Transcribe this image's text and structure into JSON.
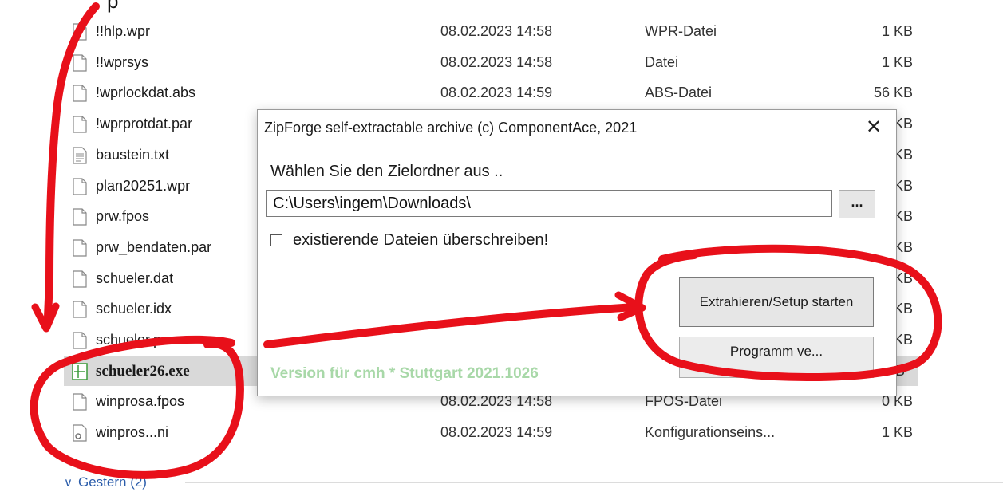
{
  "top_fragment": "p",
  "files": [
    {
      "name": "!!hlp.wpr",
      "date": "08.02.2023 14:58",
      "type": "WPR-Datei",
      "size": "1 KB",
      "icon": "file-icon"
    },
    {
      "name": "!!wprsys",
      "date": "08.02.2023 14:58",
      "type": "Datei",
      "size": "1 KB",
      "icon": "file-icon"
    },
    {
      "name": "!wprlockdat.abs",
      "date": "08.02.2023 14:59",
      "type": "ABS-Datei",
      "size": "56 KB",
      "icon": "file-icon"
    },
    {
      "name": "!wprprotdat.par",
      "date": "",
      "type": "",
      "size": "KB",
      "icon": "file-icon"
    },
    {
      "name": "baustein.txt",
      "date": "",
      "type": "",
      "size": "KB",
      "icon": "text-file-icon"
    },
    {
      "name": "plan20251.wpr",
      "date": "",
      "type": "",
      "size": "KB",
      "icon": "file-icon"
    },
    {
      "name": "prw.fpos",
      "date": "",
      "type": "",
      "size": "KB",
      "icon": "file-icon"
    },
    {
      "name": "prw_bendaten.par",
      "date": "",
      "type": "",
      "size": "KB",
      "icon": "file-icon"
    },
    {
      "name": "schueler.dat",
      "date": "",
      "type": "",
      "size": "KB",
      "icon": "file-icon"
    },
    {
      "name": "schueler.idx",
      "date": "",
      "type": "",
      "size": "KB",
      "icon": "file-icon"
    },
    {
      "name": "schueler.par",
      "date": "",
      "type": "",
      "size": "KB",
      "icon": "file-icon"
    },
    {
      "name": "schueler26.exe",
      "date": "",
      "type": "",
      "size": "KB",
      "icon": "exe-icon",
      "selected": true
    },
    {
      "name": "winprosa.fpos",
      "date": "08.02.2023 14:58",
      "type": "FPOS-Datei",
      "size": "0 KB",
      "icon": "file-icon"
    },
    {
      "name": "winpros...ni",
      "date": "08.02.2023 14:59",
      "type": "Konfigurationseins...",
      "size": "1 KB",
      "icon": "config-file-icon"
    }
  ],
  "group": {
    "label": "Gestern (2)"
  },
  "dialog": {
    "title": "ZipForge self-extractable archive (c) ComponentAce, 2021",
    "prompt": "Wählen Sie den Zielordner aus ..",
    "path_value": "C:\\Users\\ingem\\Downloads\\",
    "browse_label": "...",
    "overwrite_label": "existierende Dateien überschreiben!",
    "extract_label": "Extrahieren/Setup starten",
    "cancel_label": "Programm ve...",
    "version": "Version für cmh * Stuttgart 2021.1026"
  },
  "colors": {
    "annotation": "#e8101a",
    "selection": "#d9d9d9",
    "version_text": "#a8d8a8"
  }
}
